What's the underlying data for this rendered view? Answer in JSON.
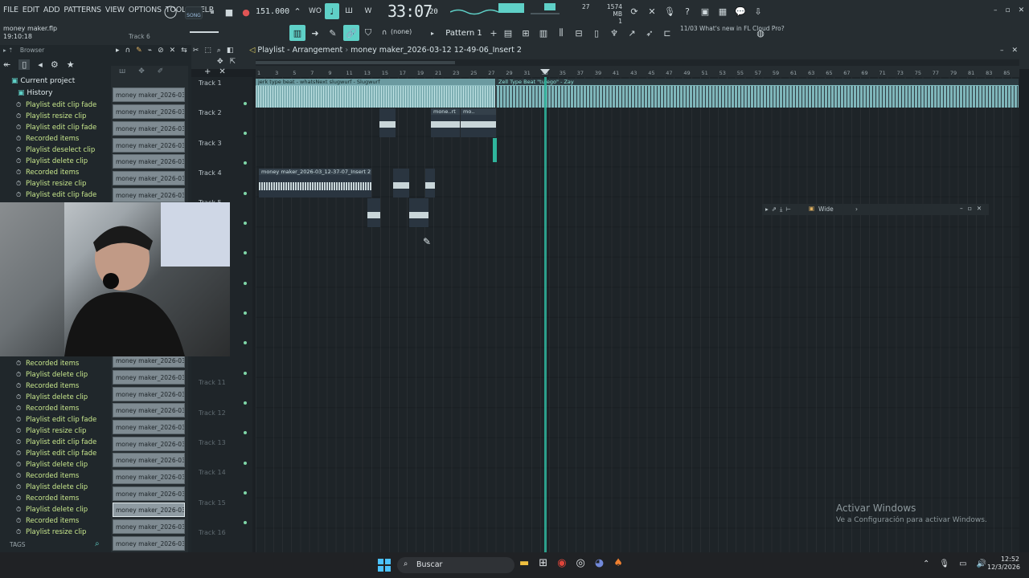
{
  "menu": [
    "FILE",
    "EDIT",
    "ADD",
    "PATTERNS",
    "VIEW",
    "OPTIONS",
    "TOOLS",
    "HELP"
  ],
  "project": {
    "file": "money maker.flp",
    "time": "19:10:18",
    "track_hint": "Track 6"
  },
  "transport": {
    "mode": "SONG",
    "tempo": "151.000",
    "time_big": "33:07",
    "time_small": "20",
    "cpu": "27",
    "cpu2": "1",
    "memory": "1574 MB",
    "memory2": "0"
  },
  "toolbar2": {
    "snap": "(none)",
    "pattern": "Pattern 1",
    "news_date": "11/03",
    "news_text": "What's new in FL Cloud Pro?"
  },
  "browser": {
    "title": "Browser",
    "current_project": "Current project",
    "history": "History",
    "history_items": [
      "Playlist edit clip fade",
      "Playlist resize clip",
      "Playlist edit clip fade",
      "Recorded items",
      "Playlist deselect clip",
      "Playlist delete clip",
      "Recorded items",
      "Playlist resize clip",
      "Playlist edit clip fade"
    ],
    "history_items_lower": [
      "Recorded items",
      "Playlist delete clip",
      "Recorded items",
      "Playlist delete clip",
      "Recorded items",
      "Playlist edit clip fade",
      "Playlist resize clip",
      "Playlist edit clip fade",
      "Playlist edit clip fade",
      "Playlist delete clip",
      "Recorded items",
      "Playlist delete clip",
      "Recorded items",
      "Playlist delete clip",
      "Recorded items",
      "Playlist resize clip"
    ],
    "tags": "TAGS"
  },
  "patterns": [
    "money maker_2026-03-...",
    "money maker_2026-03-...",
    "money maker_2026-03-...",
    "money maker_2026-03-...",
    "money maker_2026-03-...",
    "money maker_2026-03-...",
    "money maker_2026-03-...",
    "money maker_2026-03-..."
  ],
  "patterns_lower": [
    "money maker_2026-03-...",
    "money maker_2026-03-...",
    "money maker_2026-03-...",
    "money maker_2026-03-...",
    "money maker_2026-03-...",
    "money maker_2026-03-...",
    "money maker_2026-03-...",
    "money maker_2026-03-...",
    "money maker_2026-03-...",
    "money maker_2026-03-...",
    "money maker_2026-03-...",
    "money maker_2026-03-..."
  ],
  "playlist": {
    "title": "Playlist - Arrangement",
    "path": "money maker_2026-03-12 12-49-06_Insert 2",
    "ruler": [
      "1",
      "3",
      "5",
      "7",
      "9",
      "11",
      "13",
      "15",
      "17",
      "19",
      "21",
      "23",
      "25",
      "27",
      "29",
      "31",
      "33",
      "35",
      "37",
      "39",
      "41",
      "43",
      "45",
      "47",
      "49",
      "51",
      "53",
      "55",
      "57",
      "59",
      "61",
      "63",
      "65",
      "67",
      "69",
      "71",
      "73",
      "75",
      "77",
      "79",
      "81",
      "83",
      "85"
    ],
    "tracks": [
      "Track 1",
      "Track 2",
      "Track 3",
      "Track 4",
      "Track 5",
      "Track 11",
      "Track 12",
      "Track 13",
      "Track 14",
      "Track 15",
      "Track 16"
    ],
    "clips": {
      "jerk": "jerk type beat - whatsNext slugwurf - Slugwurf",
      "zell": "Zell Type Beat \"tu ego\" - Zay",
      "mone": "mone..rt",
      "mo": "mo..",
      "insert2": "money maker_2026-03_12-37-07_Insert 2"
    }
  },
  "wide_panel": {
    "label": "Wide"
  },
  "watermark": {
    "line1": "Activar Windows",
    "line2": "Ve a Configuración para activar Windows."
  },
  "taskbar": {
    "search": "Buscar",
    "time": "12:52",
    "date": "12/3/2026"
  }
}
